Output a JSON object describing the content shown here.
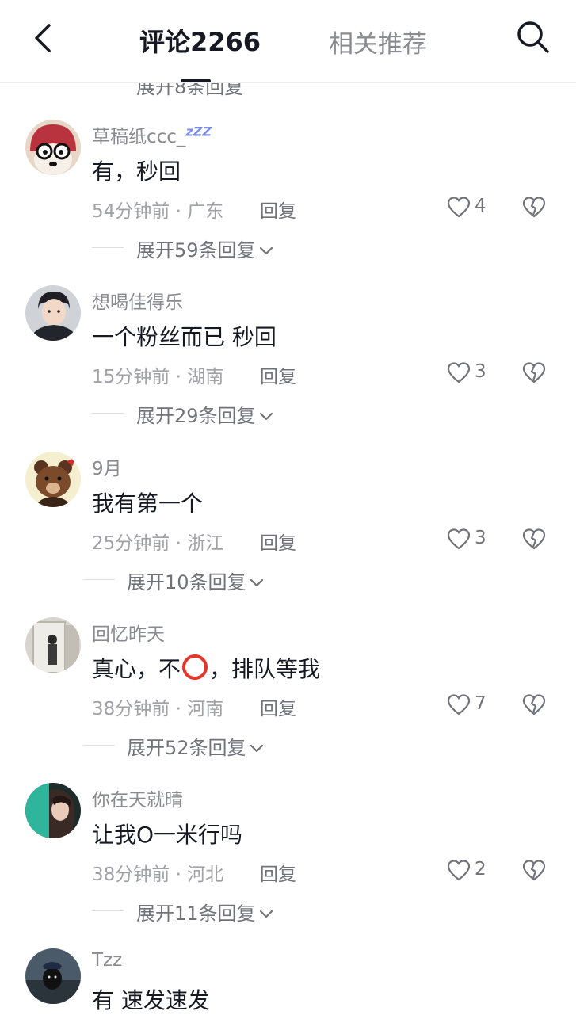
{
  "header": {
    "comments_tab": "评论2266",
    "related_tab": "相关推荐"
  },
  "peek_expand": "展开8条回复",
  "comments": [
    {
      "username": "草稿纸ccc_",
      "username_suffix": "zZZ",
      "text": "有，秒回",
      "time": "54分钟前",
      "location": "广东",
      "meta": "54分钟前 · 广东",
      "reply": "回复",
      "likes": "4",
      "expand": "展开59条回复",
      "avatar": "cartoon-glasses-avatar"
    },
    {
      "username": "想喝佳得乐",
      "text": "一个粉丝而已 秒回",
      "time": "15分钟前",
      "location": "湖南",
      "meta": "15分钟前 · 湖南",
      "reply": "回复",
      "likes": "3",
      "expand": "展开29条回复",
      "avatar": "boy-photo-avatar"
    },
    {
      "username": "9月",
      "text": "我有第一个",
      "time": "25分钟前",
      "location": "浙江",
      "meta": "25分钟前 · 浙江",
      "reply": "回复",
      "likes": "3",
      "expand": "展开10条回复",
      "avatar": "bear-avatar"
    },
    {
      "username": "回忆昨天",
      "text_before": "真心，不",
      "text_after": "，排队等我",
      "time": "38分钟前",
      "location": "河南",
      "meta": "38分钟前 · 河南",
      "reply": "回复",
      "likes": "7",
      "expand": "展开52条回复",
      "avatar": "mirror-selfie-avatar"
    },
    {
      "username": "你在天就晴",
      "text": "让我O一米行吗",
      "time": "38分钟前",
      "location": "河北",
      "meta": "38分钟前 · 河北",
      "reply": "回复",
      "likes": "2",
      "expand": "展开11条回复",
      "avatar": "girl-teal-avatar"
    },
    {
      "username": "Tzz",
      "text": "有 速发速发",
      "avatar": "dark-dog-avatar"
    }
  ],
  "colors": {
    "primary_text": "#161823",
    "secondary_text": "#8a8b91",
    "emoji_ring": "#e3372b"
  }
}
